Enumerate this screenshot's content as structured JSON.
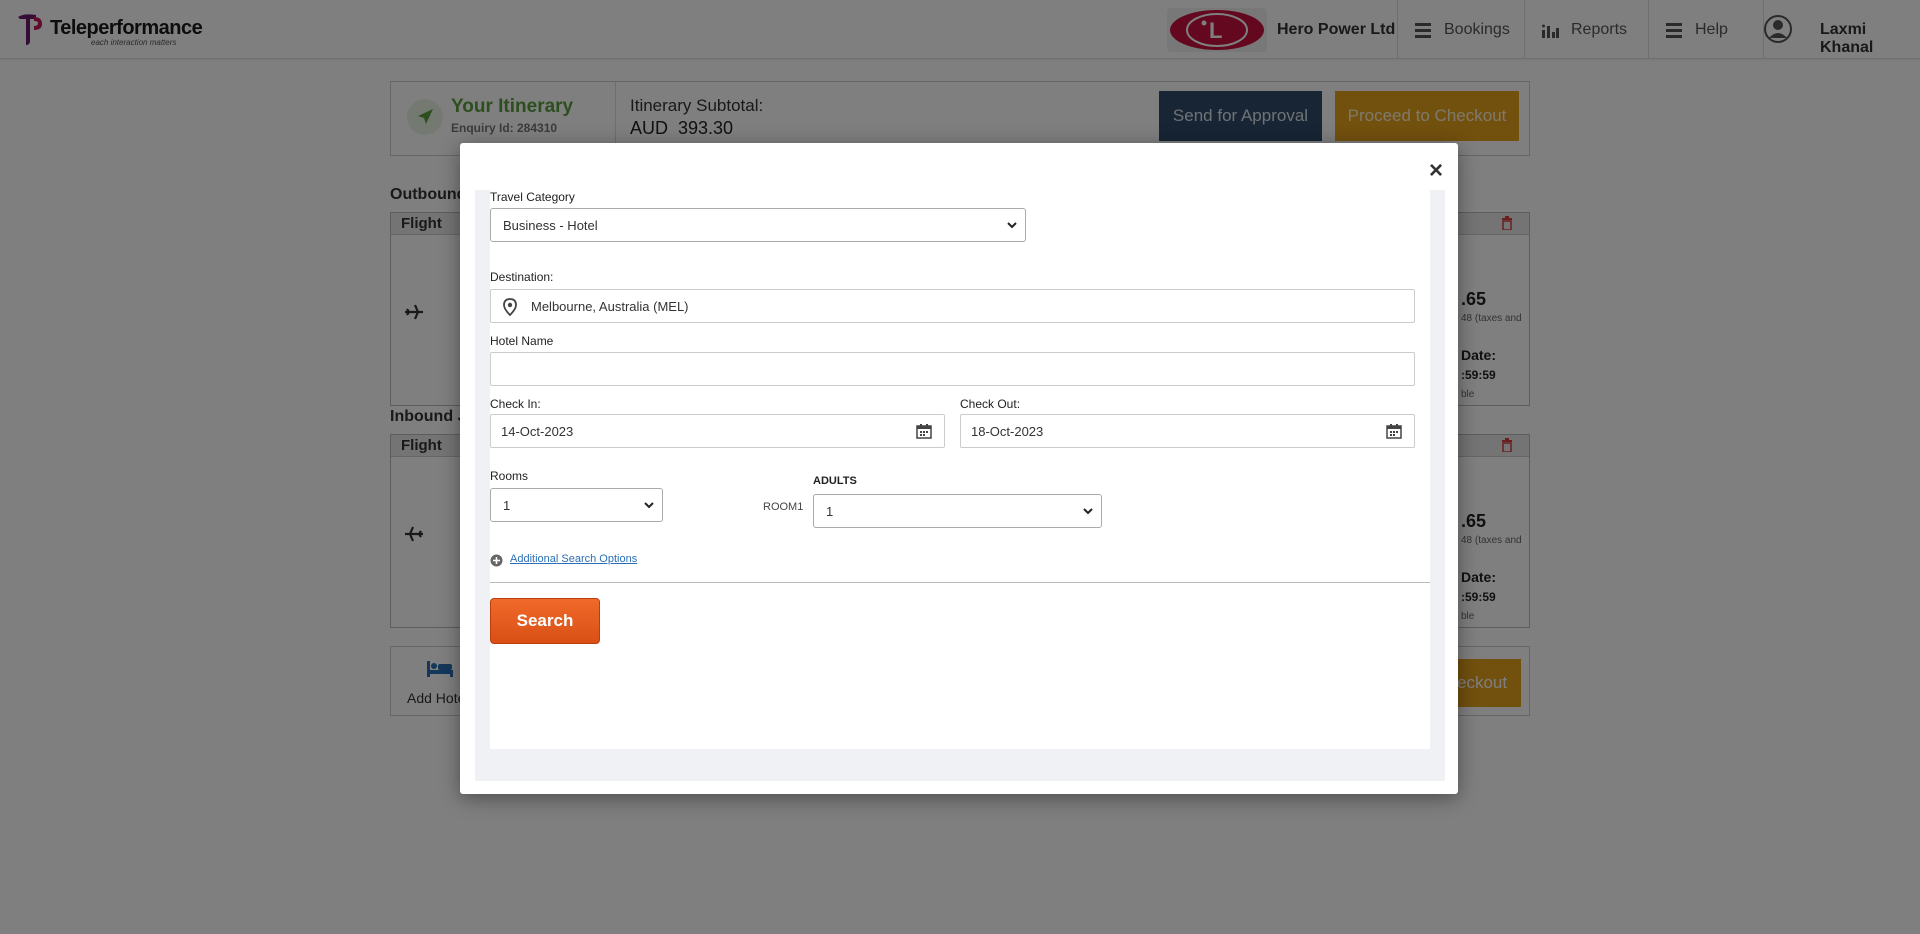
{
  "header": {
    "logo_text": "Teleperformance",
    "logo_tagline": "each interaction matters",
    "company": "Hero Power Ltd",
    "nav": {
      "bookings": "Bookings",
      "reports": "Reports",
      "help": "Help"
    },
    "user_name": "Laxmi Khanal"
  },
  "itinerary": {
    "title": "Your Itinerary",
    "enquiry": "Enquiry Id: 284310",
    "subtotal_label": "Itinerary Subtotal:",
    "subtotal_value": "AUD  393.30",
    "send_approval": "Send for Approval",
    "proceed_checkout": "Proceed to Checkout"
  },
  "outbound": {
    "label": "Outbound",
    "card_title": "Flight",
    "price": ".65",
    "tax": "48 (taxes and",
    "date_label": "Date:",
    "time": ":59:59",
    "avail": "ble"
  },
  "inbound": {
    "label": "Inbound J",
    "card_title": "Flight",
    "price": ".65",
    "tax": "48 (taxes and",
    "date_label": "Date:",
    "time": ":59:59",
    "avail": "ble"
  },
  "bottom": {
    "add_hotel": "Add Hote",
    "checkout": "eckout"
  },
  "modal": {
    "close": "×",
    "travel_category_label": "Travel Category",
    "travel_category_value": "Business - Hotel",
    "destination_label": "Destination:",
    "destination_value": "Melbourne, Australia (MEL)",
    "hotel_name_label": "Hotel Name",
    "hotel_name_value": "",
    "check_in_label": "Check In:",
    "check_in_value": "14-Oct-2023",
    "check_out_label": "Check Out:",
    "check_out_value": "18-Oct-2023",
    "rooms_label": "Rooms",
    "rooms_value": "1",
    "adults_label": "ADULTS",
    "room1_label": "ROOM1",
    "adults_value": "1",
    "additional_options": "Additional Search Options",
    "search": "Search"
  },
  "colors": {
    "itinerary_green": "#5a9f3e",
    "approval_blue": "#2f4a6b",
    "checkout_orange": "#e5a11c",
    "search_orange": "#e85c1f",
    "link_blue": "#2a6fb5"
  }
}
